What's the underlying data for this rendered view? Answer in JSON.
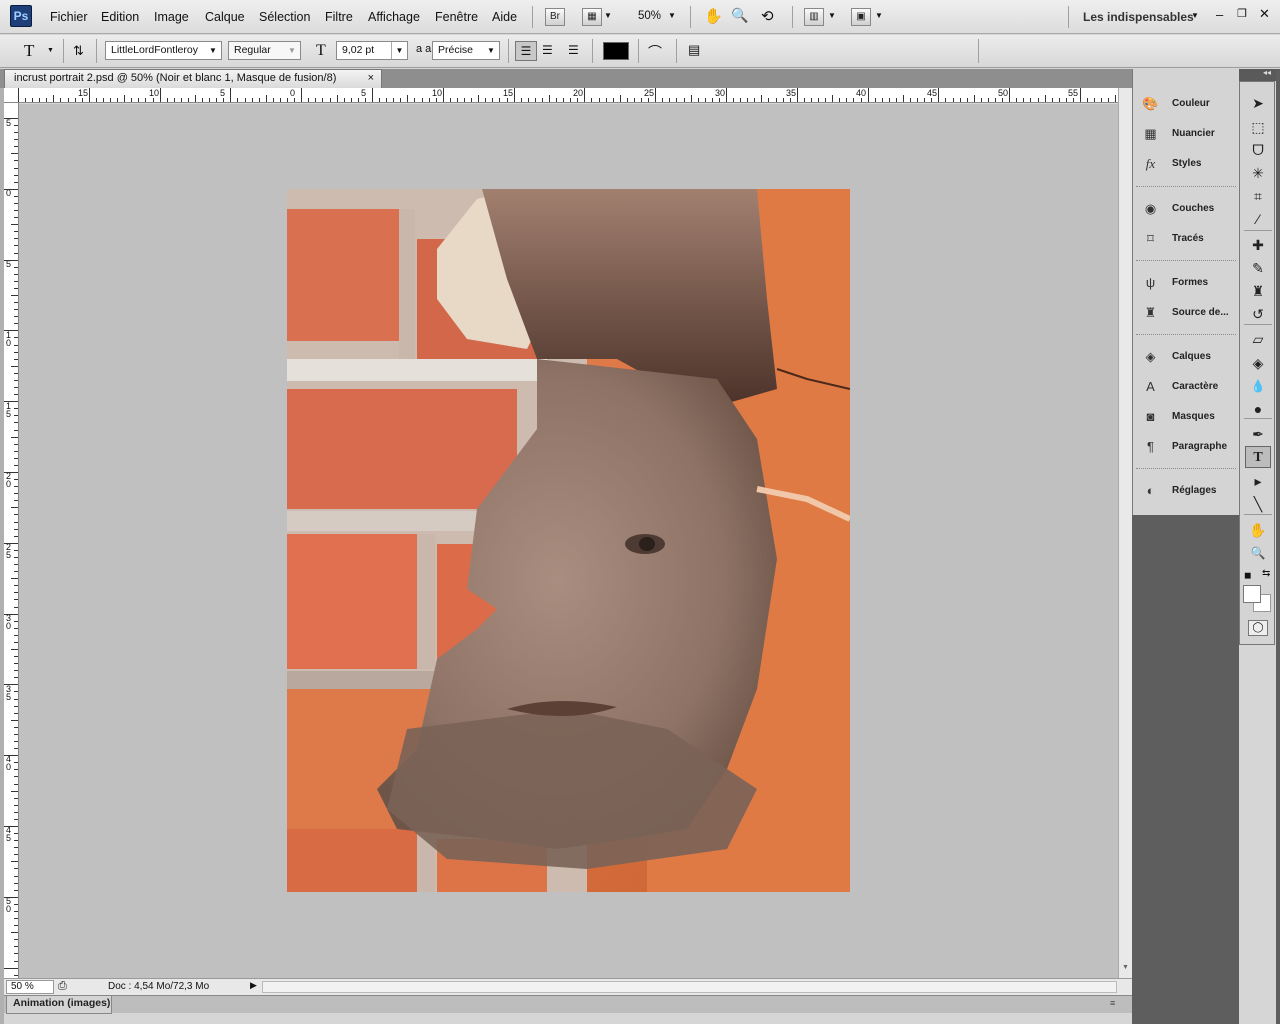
{
  "menu": {
    "app_logo": "Ps",
    "items": [
      "Fichier",
      "Edition",
      "Image",
      "Calque",
      "Sélection",
      "Filtre",
      "Affichage",
      "Fenêtre",
      "Aide"
    ],
    "bridge_label": "Br",
    "zoom": "50%",
    "workspace": "Les indispensables"
  },
  "options": {
    "tool_letter": "T",
    "font_family": "LittleLordFontleroy",
    "font_style": "Regular",
    "font_size": "9,02 pt",
    "aa_label": "a a",
    "antialias": "Précise",
    "text_color": "#000000"
  },
  "document": {
    "tab_title": "incrust portrait 2.psd @ 50% (Noir et blanc 1, Masque de fusion/8)",
    "close": "×"
  },
  "rulers": {
    "h_labels": [
      "15",
      "10",
      "5",
      "0",
      "5",
      "10",
      "15",
      "20",
      "25",
      "30",
      "35",
      "40",
      "45",
      "50",
      "55"
    ],
    "v_labels": [
      "5",
      "0",
      "5",
      "10",
      "15",
      "20",
      "25",
      "30",
      "35",
      "40",
      "45",
      "50"
    ]
  },
  "status": {
    "zoom": "50 %",
    "doc_info": "Doc : 4,54 Mo/72,3 Mo",
    "animation_tab": "Animation (images)"
  },
  "panels": [
    {
      "group": 1,
      "items": [
        {
          "label": "Couleur",
          "icon": "color-palette-icon"
        },
        {
          "label": "Nuancier",
          "icon": "swatches-grid-icon"
        },
        {
          "label": "Styles",
          "icon": "fx-styles-icon"
        }
      ]
    },
    {
      "group": 2,
      "items": [
        {
          "label": "Couches",
          "icon": "channels-icon"
        },
        {
          "label": "Tracés",
          "icon": "paths-icon"
        }
      ]
    },
    {
      "group": 3,
      "items": [
        {
          "label": "Formes",
          "icon": "brush-presets-icon"
        },
        {
          "label": "Source de...",
          "icon": "clone-source-icon"
        }
      ]
    },
    {
      "group": 4,
      "items": [
        {
          "label": "Calques",
          "icon": "layers-icon"
        },
        {
          "label": "Caractère",
          "icon": "character-icon"
        },
        {
          "label": "Masques",
          "icon": "masks-icon"
        },
        {
          "label": "Paragraphe",
          "icon": "paragraph-icon"
        }
      ]
    },
    {
      "group": 5,
      "items": [
        {
          "label": "Réglages",
          "icon": "adjustments-icon"
        }
      ]
    }
  ],
  "tools": [
    {
      "name": "move-tool-icon",
      "glyph": "➤"
    },
    {
      "name": "marquee-tool-icon",
      "glyph": "⬚"
    },
    {
      "name": "lasso-tool-icon",
      "glyph": "ᗜ"
    },
    {
      "name": "magic-wand-tool-icon",
      "glyph": "✳"
    },
    {
      "name": "crop-tool-icon",
      "glyph": "⌗"
    },
    {
      "name": "eyedropper-tool-icon",
      "glyph": "⁄"
    },
    {
      "name": "healing-brush-tool-icon",
      "glyph": "✚"
    },
    {
      "name": "brush-tool-icon",
      "glyph": "✎"
    },
    {
      "name": "clone-stamp-tool-icon",
      "glyph": "♜"
    },
    {
      "name": "history-brush-tool-icon",
      "glyph": "↺"
    },
    {
      "name": "eraser-tool-icon",
      "glyph": "▱"
    },
    {
      "name": "paint-bucket-tool-icon",
      "glyph": "◈"
    },
    {
      "name": "blur-tool-icon",
      "glyph": "💧"
    },
    {
      "name": "dodge-tool-icon",
      "glyph": "●"
    },
    {
      "name": "pen-tool-icon",
      "glyph": "✒"
    },
    {
      "name": "type-tool-icon",
      "glyph": "T"
    },
    {
      "name": "path-selection-tool-icon",
      "glyph": "▸"
    },
    {
      "name": "line-tool-icon",
      "glyph": "╲"
    },
    {
      "name": "hand-tool-icon",
      "glyph": "✋"
    },
    {
      "name": "zoom-tool-icon",
      "glyph": "🔍"
    }
  ]
}
